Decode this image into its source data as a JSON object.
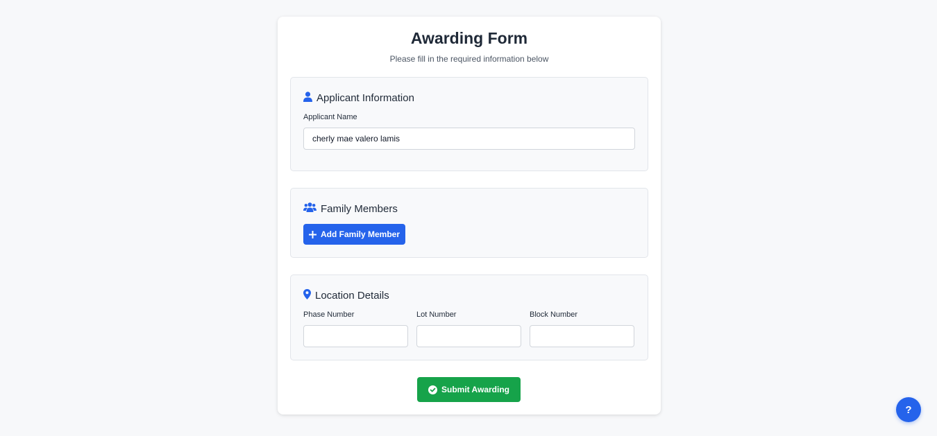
{
  "form": {
    "title": "Awarding Form",
    "subtitle": "Please fill in the required information below"
  },
  "applicant": {
    "heading": "Applicant Information",
    "icon": "user-icon",
    "name_label": "Applicant Name",
    "name_value": "cherly mae valero lamis"
  },
  "family": {
    "heading": "Family Members",
    "icon": "users-icon",
    "add_button_label": "Add Family Member",
    "add_button_icon": "plus-icon"
  },
  "location": {
    "heading": "Location Details",
    "icon": "map-pin-icon",
    "phase_label": "Phase Number",
    "phase_value": "",
    "lot_label": "Lot Number",
    "lot_value": "",
    "block_label": "Block Number",
    "block_value": ""
  },
  "submit": {
    "label": "Submit Awarding",
    "icon": "check-circle-icon"
  },
  "help": {
    "label": "?"
  },
  "colors": {
    "accent": "#2563eb",
    "success": "#16a34a",
    "background": "#f7f8fa"
  }
}
